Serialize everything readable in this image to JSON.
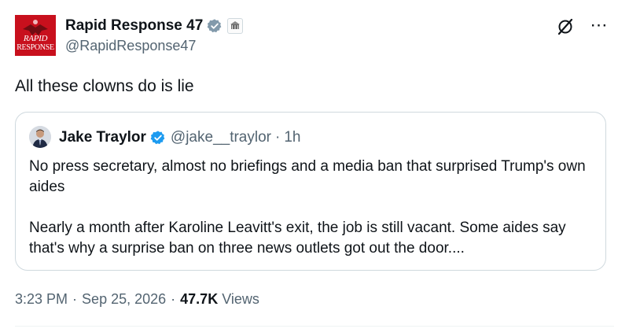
{
  "author": {
    "display_name": "Rapid Response 47",
    "handle": "@RapidResponse47",
    "avatar_text_top": "RAPID",
    "avatar_text_bottom": "RESPONSE",
    "avatar_color": "#c8101d",
    "verified_icon": "verified-badge-icon",
    "affiliation_icon": "white-house-seal-icon"
  },
  "tweet": {
    "text": "All these clowns do is lie"
  },
  "quoted_tweet": {
    "display_name": "Jake Traylor",
    "handle": "@jake__traylor",
    "separator": "·",
    "time": "1h",
    "paragraph_1": "No press secretary, almost no briefings and a media ban that surprised Trump's own aides",
    "paragraph_2": "Nearly a month after Karoline Leavitt's exit, the job is still vacant. Some aides say that's why a surprise ban on three news outlets got out the door...."
  },
  "meta": {
    "time": "3:23 PM",
    "separator": "·",
    "date": "Sep 25, 2026",
    "views_count": "47.7K",
    "views_label": "Views"
  },
  "colors": {
    "text_primary": "#0f1419",
    "text_secondary": "#536471",
    "verified_blue": "#1d9bf0",
    "border": "#cfd9de"
  }
}
